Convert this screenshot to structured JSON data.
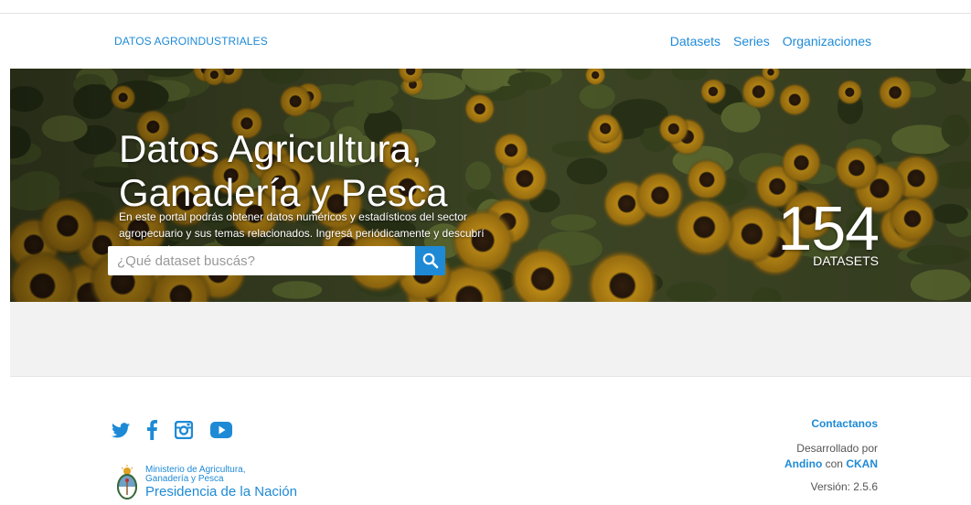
{
  "header": {
    "brand": "DATOS AGROINDUSTRIALES",
    "nav": [
      "Datasets",
      "Series",
      "Organizaciones"
    ]
  },
  "hero": {
    "title_line1": "Datos Agricultura,",
    "title_line2": "Ganadería y Pesca",
    "description": "En este portal podrás obtener datos numéricos y estadísticos del sector agropecuario y sus temas relacionados. Ingresá periódicamente y descubrí nuestros datos.",
    "search_placeholder": "¿Qué dataset buscás?",
    "dataset_count": "154",
    "dataset_label": "DATASETS"
  },
  "footer": {
    "social_icons": [
      "twitter-icon",
      "facebook-icon",
      "instagram-icon",
      "youtube-icon"
    ],
    "ministry_line1": "Ministerio de Agricultura,",
    "ministry_line2": "Ganadería y Pesca",
    "ministry_line3": "Presidencia de la Nación",
    "contact": "Contactanos",
    "developed_by": "Desarrollado por",
    "andino": "Andino",
    "con": "con",
    "ckan": "CKAN",
    "version": "Versión: 2.5.6"
  },
  "colors": {
    "accent": "#1e8ad6",
    "hero_bg": "#3b3a20",
    "band": "#f2f2f2"
  }
}
